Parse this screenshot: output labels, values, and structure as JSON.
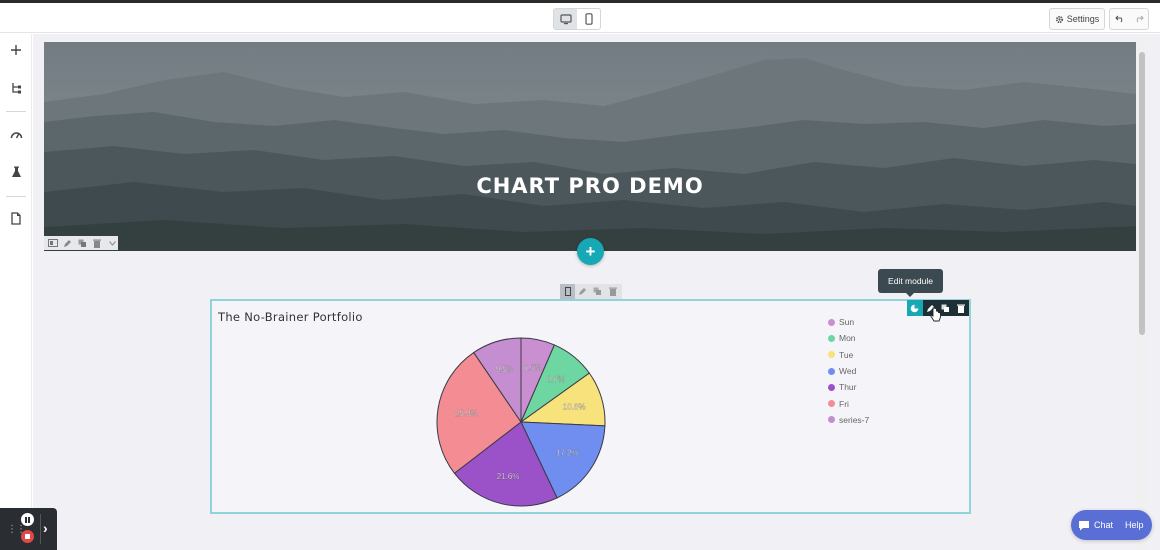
{
  "toolbar": {
    "device_desktop": "desktop-icon",
    "device_mobile": "mobile-icon",
    "settings_label": "Settings",
    "undo": "undo-icon",
    "redo": "redo-icon"
  },
  "sidebar": {
    "items": [
      "add-icon",
      "navigator-icon",
      "performance-icon",
      "flask-icon",
      "page-icon"
    ]
  },
  "hero": {
    "title": "CHART PRO DEMO"
  },
  "module": {
    "tooltip": "Edit module",
    "chart_title": "The No-Brainer Portfolio"
  },
  "chart_data": {
    "type": "pie",
    "title": "The No-Brainer Portfolio",
    "legend_position": "right",
    "categories": [
      "Sun",
      "Mon",
      "Tue",
      "Wed",
      "Thur",
      "Fri",
      "series-7"
    ],
    "values": [
      6.5,
      8.6,
      10.6,
      17.2,
      21.6,
      25.9,
      9.5
    ],
    "labels": [
      "6.5%",
      "8.6%",
      "10.6%",
      "17.2%",
      "21.6%",
      "25.9%",
      "9.5%"
    ],
    "colors": [
      "#c98fd0",
      "#6ed6a1",
      "#f7e27c",
      "#6f8ef0",
      "#9b52c9",
      "#f48c94",
      "#c58ed0"
    ]
  },
  "chat": {
    "chat_label": "Chat",
    "help_label": "Help"
  },
  "colors": {
    "accent": "#16a8b4",
    "module_border": "#8fd4d8",
    "chat_bg": "#5a6fd6"
  }
}
